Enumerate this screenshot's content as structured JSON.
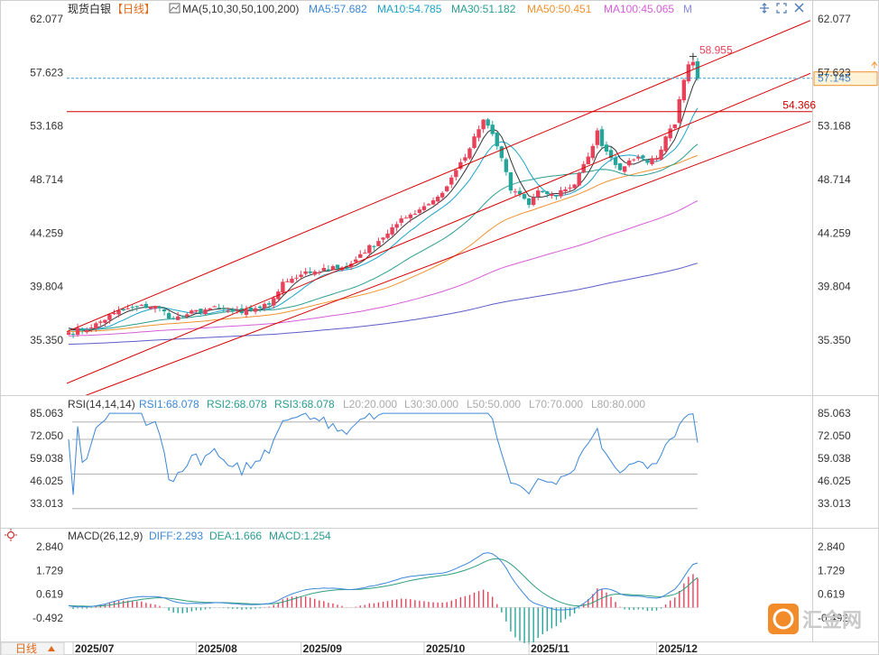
{
  "colors": {
    "up": "#e8425a",
    "down": "#26a69a",
    "channel": "#d40000",
    "ma5": "#333333",
    "ma10": "#1aa3c8",
    "ma30": "#2a9d8f",
    "ma50": "#f0922e",
    "ma100": "#d65fd6",
    "ma200": "#5c5cc8",
    "rsi": "#3b87d8",
    "diff": "#3b87d8",
    "dea": "#2e9e7e",
    "hist_up": "#e8425a",
    "hist_down": "#26a69a",
    "price_label_bg": "#fff2d6",
    "price_label_border": "#f0922e"
  },
  "header": {
    "symbol": "现货白银",
    "period": "【日线】",
    "ma_prefix": "MA(5,10,30,50,100,200)",
    "ma5": "MA5:57.682",
    "ma10": "MA10:54.785",
    "ma30": "MA30:51.182",
    "ma50": "MA50:50.451",
    "ma100": "MA100:45.065",
    "more": "M"
  },
  "rsi_header": {
    "title": "RSI(14,14,14)",
    "rsi1": "RSI1:68.078",
    "rsi2": "RSI2:68.078",
    "rsi3": "RSI3:68.078",
    "l20": "L20:20.000",
    "l30": "L30:30.000",
    "l50": "L50:50.000",
    "l70": "L70:70.000",
    "l80": "L80:80.000"
  },
  "macd_header": {
    "title": "MACD(26,12,9)",
    "diff": "DIFF:2.293",
    "dea": "DEA:1.666",
    "macd": "MACD:1.254"
  },
  "annotations": {
    "high_label": "58.955",
    "level_label": "54.366",
    "current_price": "57.145"
  },
  "footer": {
    "period_button": "日线",
    "dates": [
      "2025/07",
      "2025/08",
      "2025/09",
      "2025/10",
      "2025/11",
      "2025/12"
    ]
  },
  "watermark": "汇金网",
  "chart_data": {
    "type": "candlestick",
    "price_axis_ticks": [
      "62.077",
      "57.623",
      "53.168",
      "48.714",
      "44.259",
      "39.804",
      "35.350"
    ],
    "rsi_axis_ticks": [
      "85.063",
      "72.050",
      "59.038",
      "46.025",
      "33.013"
    ],
    "macd_axis_ticks": [
      "2.840",
      "1.729",
      "0.619",
      "-0.492"
    ],
    "ylim": [
      32.5,
      63.2
    ],
    "price_keypoints": [
      [
        0,
        36.0
      ],
      [
        5,
        36.4
      ],
      [
        10,
        37.6
      ],
      [
        15,
        38.1
      ],
      [
        19,
        38.2
      ],
      [
        23,
        37.1
      ],
      [
        26,
        37.5
      ],
      [
        31,
        38.0
      ],
      [
        35,
        37.8
      ],
      [
        38,
        37.6
      ],
      [
        41,
        38.0
      ],
      [
        44,
        38.3
      ],
      [
        47,
        40.2
      ],
      [
        51,
        40.8
      ],
      [
        55,
        41.0
      ],
      [
        58,
        41.5
      ],
      [
        61,
        41.3
      ],
      [
        64,
        42.5
      ],
      [
        68,
        43.6
      ],
      [
        72,
        45.0
      ],
      [
        75,
        45.8
      ],
      [
        78,
        46.5
      ],
      [
        82,
        47.6
      ],
      [
        85,
        49.5
      ],
      [
        88,
        51.3
      ],
      [
        90,
        52.9
      ],
      [
        91,
        53.7
      ],
      [
        92,
        53.2
      ],
      [
        93,
        52.5
      ],
      [
        95,
        50.5
      ],
      [
        97,
        47.8
      ],
      [
        99,
        47.5
      ],
      [
        101,
        46.6
      ],
      [
        103,
        47.8
      ],
      [
        105,
        47.5
      ],
      [
        107,
        47.3
      ],
      [
        109,
        47.9
      ],
      [
        111,
        48.3
      ],
      [
        113,
        50.0
      ],
      [
        115,
        51.5
      ],
      [
        116,
        52.8
      ],
      [
        117,
        51.5
      ],
      [
        119,
        50.5
      ],
      [
        121,
        49.5
      ],
      [
        123,
        50.3
      ],
      [
        125,
        50.6
      ],
      [
        127,
        50.1
      ],
      [
        129,
        50.5
      ],
      [
        131,
        52.3
      ],
      [
        133,
        53.3
      ],
      [
        134,
        55.4
      ],
      [
        135,
        57.0
      ],
      [
        136,
        58.3
      ],
      [
        137,
        58.5
      ],
      [
        138,
        57.145
      ]
    ],
    "ma_series": [
      {
        "name": "MA5",
        "values": [
          57.682
        ]
      },
      {
        "name": "MA10",
        "values": [
          54.785
        ]
      },
      {
        "name": "MA30",
        "values": [
          51.182
        ]
      },
      {
        "name": "MA50",
        "values": [
          50.451
        ]
      },
      {
        "name": "MA100",
        "values": [
          45.065
        ]
      }
    ],
    "horizontal_level": 54.366,
    "high": 58.955,
    "last_close": 57.145,
    "rsi": {
      "rsi1": 68.078,
      "rsi2": 68.078,
      "rsi3": 68.078,
      "levels": [
        20,
        30,
        50,
        70,
        80
      ]
    },
    "macd": {
      "diff": 2.293,
      "dea": 1.666,
      "macd": 1.254
    },
    "x_labels": [
      "2025/07",
      "2025/08",
      "2025/09",
      "2025/10",
      "2025/11",
      "2025/12"
    ]
  }
}
